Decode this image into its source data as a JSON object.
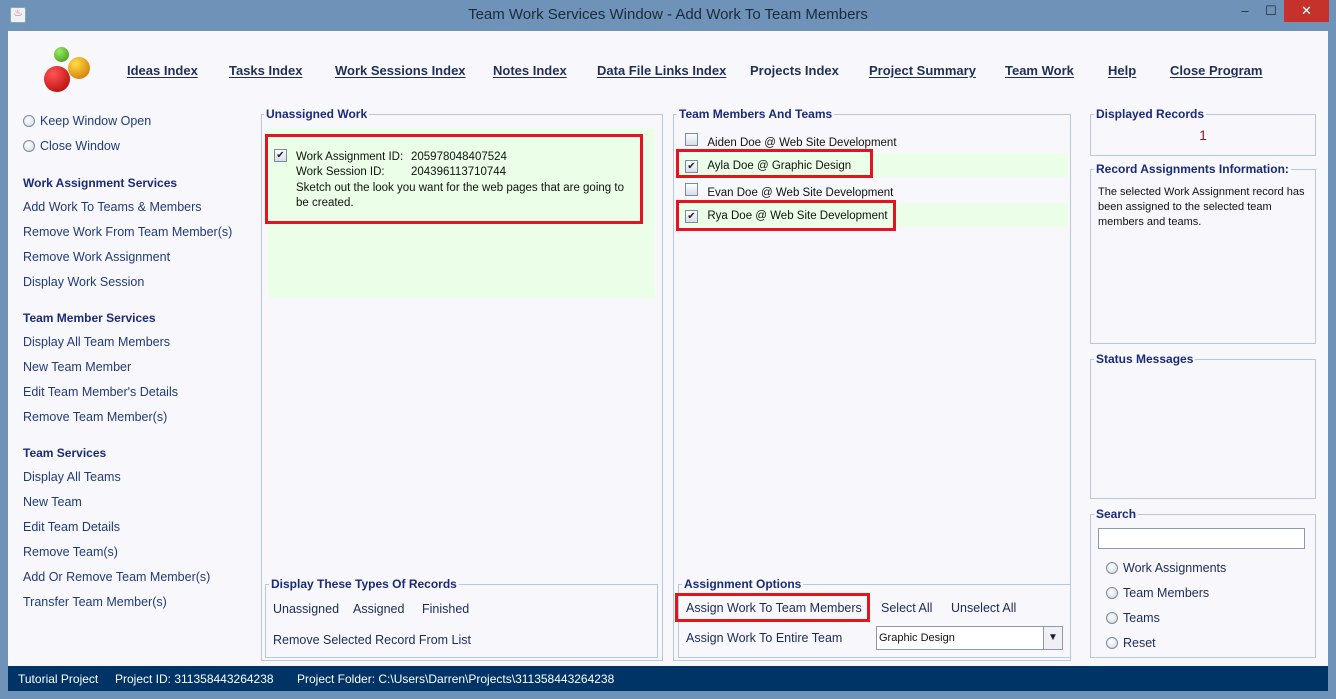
{
  "window": {
    "title": "Team Work Services Window - Add Work To Team Members",
    "minimize": "–",
    "maximize": "☐",
    "close": "✕"
  },
  "nav": [
    "Ideas Index",
    "Tasks Index",
    "Work Sessions Index",
    "Notes Index",
    "Data File Links Index",
    "Projects Index",
    "Project Summary",
    "Team Work",
    "Help",
    "Close Program"
  ],
  "left": {
    "window_options": [
      "Keep Window Open",
      "Close Window"
    ],
    "sections": [
      {
        "title": "Work Assignment Services",
        "items": [
          "Add Work To Teams & Members",
          "Remove Work From Team Member(s)",
          "Remove Work Assignment",
          "Display Work Session"
        ]
      },
      {
        "title": "Team Member Services",
        "items": [
          "Display All Team Members",
          "New Team Member",
          "Edit Team Member's Details",
          "Remove Team Member(s)"
        ]
      },
      {
        "title": "Team Services",
        "items": [
          "Display All Teams",
          "New Team",
          "Edit Team Details",
          "Remove Team(s)",
          "Add Or Remove Team Member(s)",
          "Transfer Team Member(s)"
        ]
      }
    ]
  },
  "unassigned": {
    "title": "Unassigned Work",
    "record": {
      "checked": true,
      "assignment_label": "Work Assignment ID:",
      "assignment_id": "205978048407524",
      "session_label": "Work Session ID:",
      "session_id": "204396113710744",
      "description": "Sketch out the look you want for the web pages that are going to be created."
    }
  },
  "display_types": {
    "title": "Display These Types Of Records",
    "options": [
      "Unassigned",
      "Assigned",
      "Finished"
    ],
    "remove": "Remove Selected Record From List"
  },
  "members": {
    "title": "Team Members And Teams",
    "items": [
      {
        "label": "Aiden Doe @ Web Site Development",
        "checked": false
      },
      {
        "label": "Ayla Doe @ Graphic Design",
        "checked": true
      },
      {
        "label": "Evan Doe @ Web Site Development",
        "checked": false
      },
      {
        "label": "Rya Doe @ Web Site Development",
        "checked": true
      }
    ]
  },
  "assignment_options": {
    "title": "Assignment Options",
    "assign": "Assign Work To Team Members",
    "select_all": "Select All",
    "unselect_all": "Unselect All",
    "entire_team": "Assign Work To Entire Team",
    "team_selected": "Graphic Design"
  },
  "displayed_records": {
    "title": "Displayed Records",
    "count": "1"
  },
  "record_info": {
    "title": "Record Assignments Information:",
    "text": "The selected Work Assignment record has been assigned to the selected team members and teams."
  },
  "status": {
    "title": "Status Messages"
  },
  "search": {
    "title": "Search",
    "value": "",
    "options": [
      "Work Assignments",
      "Team Members",
      "Teams",
      "Reset"
    ]
  },
  "statusbar": {
    "project": "Tutorial Project",
    "project_id": "Project ID:  311358443264238",
    "folder": "Project Folder: C:\\Users\\Darren\\Projects\\311358443264238"
  },
  "colors": {
    "titlebar": "#6f93b8",
    "statusbar": "#003366",
    "highlight": "#ebffe8",
    "annotation": "#e3141e",
    "close": "#c7312b"
  }
}
